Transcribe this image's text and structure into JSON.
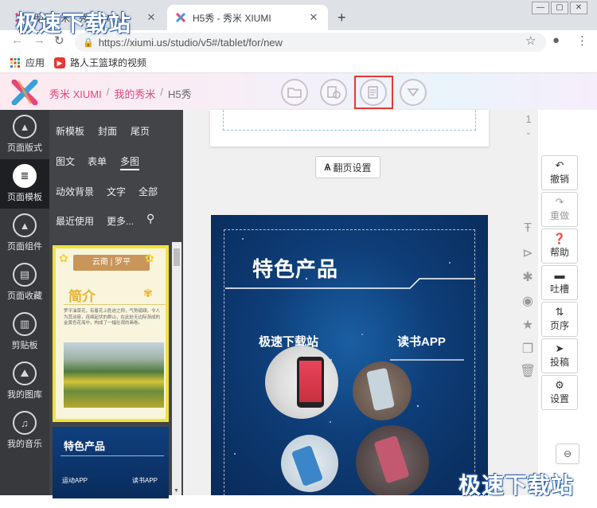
{
  "browser": {
    "tabs": [
      {
        "title": "我的秀米 - 秀米 XIUMI",
        "active": false
      },
      {
        "title": "H5秀 - 秀米 XIUMI",
        "active": true
      }
    ],
    "new_tab": "+",
    "url": "https://xiumi.us/studio/v5#/tablet/for/new",
    "bookmarks": [
      {
        "label": "应用",
        "icon": "apps-grid-icon"
      },
      {
        "label": "路人王篮球的视频",
        "icon": "video-icon"
      }
    ]
  },
  "header": {
    "breadcrumb": [
      "秀米 XIUMI",
      "我的秀米",
      "H5秀"
    ],
    "separator": "/",
    "tools": [
      "folder-icon",
      "preview-icon",
      "save-icon",
      "dropdown-icon"
    ]
  },
  "sidebar": {
    "items": [
      {
        "label": "页面版式",
        "icon": "layout-icon"
      },
      {
        "label": "页面模板",
        "icon": "template-icon",
        "active": true
      },
      {
        "label": "页面组件",
        "icon": "component-icon"
      },
      {
        "label": "页面收藏",
        "icon": "favorite-icon"
      },
      {
        "label": "剪贴板",
        "icon": "clipboard-icon"
      },
      {
        "label": "我的图库",
        "icon": "image-icon"
      },
      {
        "label": "我的音乐",
        "icon": "music-icon"
      }
    ]
  },
  "panel": {
    "categories": [
      "新模板",
      "封面",
      "尾页",
      "图文",
      "表单",
      "多图",
      "动效背景",
      "文字",
      "全部",
      "最近使用",
      "更多..."
    ],
    "active_category": "多图",
    "thumb1": {
      "badge": "云南 | 罗平",
      "heading": "简介",
      "body": "罗平油菜花，有着花上胜迹之称，气势磅礴，令人为其动容，连绵起伏的群山，在此处无边际渐成的金黄色花海中，构成了一幅壮观的画卷。"
    },
    "thumb2": {
      "heading": "特色产品",
      "label1": "运动APP",
      "label2": "读书APP"
    }
  },
  "canvas": {
    "flip_settings": "翻页设置",
    "page_number": "1",
    "page": {
      "title": "特色产品",
      "left_label": "极速下载站",
      "right_label": "读书APP"
    }
  },
  "right_tools": {
    "icons": [
      "text-icon",
      "play-icon",
      "sparkle-icon",
      "eye-off-icon",
      "star-icon",
      "copy-icon",
      "trash-icon"
    ],
    "buttons": [
      {
        "label": "撤销",
        "icon": "undo-icon"
      },
      {
        "label": "重做",
        "icon": "redo-icon",
        "disabled": true
      },
      {
        "label": "帮助",
        "icon": "help-icon"
      },
      {
        "label": "吐槽",
        "icon": "comment-icon"
      },
      {
        "label": "页序",
        "icon": "sort-icon"
      },
      {
        "label": "投稿",
        "icon": "submit-icon"
      },
      {
        "label": "设置",
        "icon": "settings-icon"
      }
    ]
  },
  "watermarks": [
    "极速下载站",
    "极速下载站"
  ],
  "colors": {
    "brand": "#e5467f",
    "sidebar": "#37393d",
    "highlight": "#e53935",
    "page_bg": "#0e3d77"
  }
}
